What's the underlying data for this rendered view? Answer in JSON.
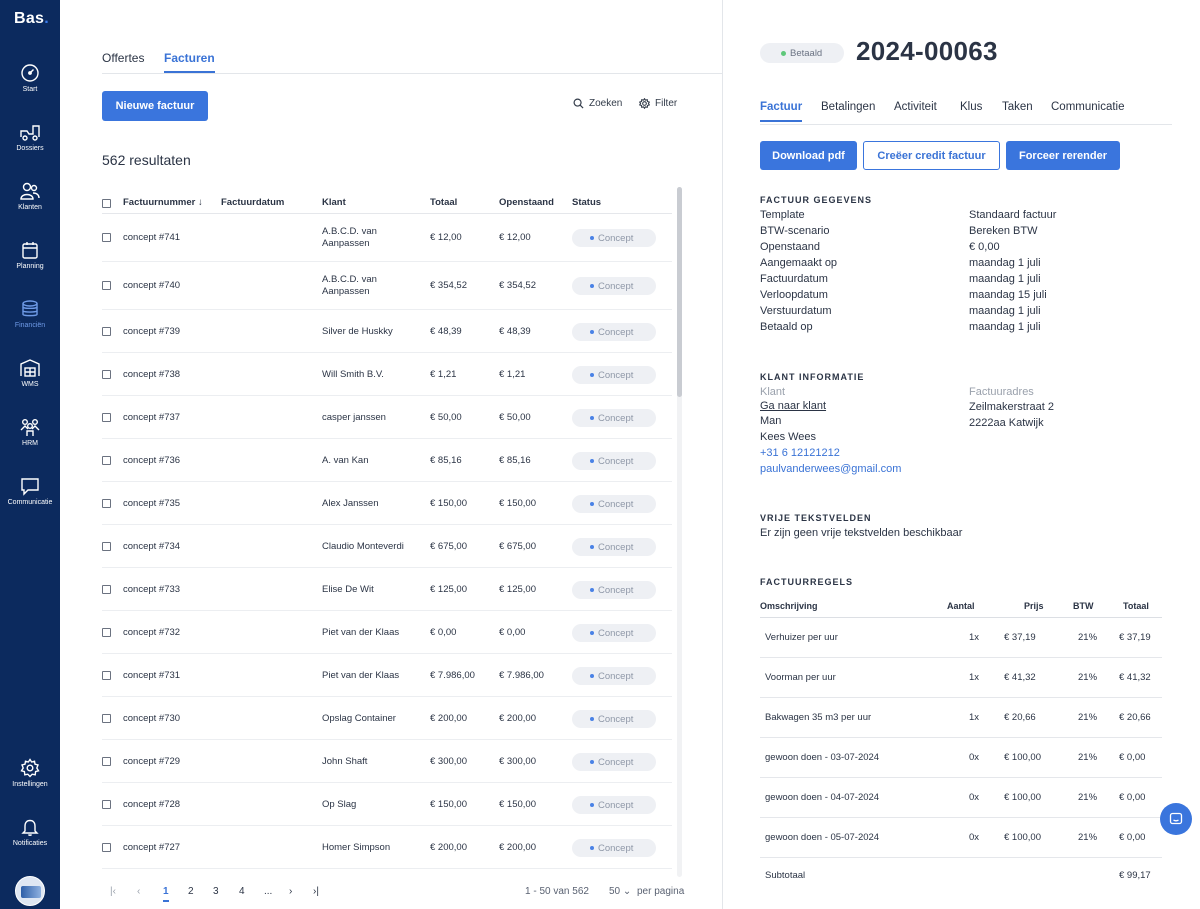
{
  "brand": {
    "logo": "Bas",
    "dot": "."
  },
  "sidebar": {
    "items": [
      {
        "label": "Start",
        "icon": "dashboard-icon"
      },
      {
        "label": "Dossiers",
        "icon": "moving-truck-icon"
      },
      {
        "label": "Klanten",
        "icon": "customers-icon"
      },
      {
        "label": "Planning",
        "icon": "calendar-icon"
      },
      {
        "label": "Financiën",
        "icon": "coins-icon",
        "active": true
      },
      {
        "label": "WMS",
        "icon": "warehouse-icon"
      },
      {
        "label": "HRM",
        "icon": "team-icon"
      },
      {
        "label": "Communicatie",
        "icon": "chat-icon"
      }
    ],
    "bottom": [
      {
        "label": "Instellingen",
        "icon": "gear-icon"
      },
      {
        "label": "Notificaties",
        "icon": "bell-icon"
      }
    ]
  },
  "left": {
    "tabs": [
      "Offertes",
      "Facturen"
    ],
    "active_tab": "Facturen",
    "new_button": "Nieuwe factuur",
    "search_label": "Zoeken",
    "filter_label": "Filter",
    "results": "562 resultaten",
    "columns": [
      "Factuurnummer",
      "Factuurdatum",
      "Klant",
      "Totaal",
      "Openstaand",
      "Status"
    ],
    "rows": [
      {
        "nr": "concept #741",
        "date": "",
        "client": [
          "A.B.C.D. van",
          "Aanpassen"
        ],
        "total": "€ 12,00",
        "open": "€ 12,00",
        "status": "Concept"
      },
      {
        "nr": "concept #740",
        "date": "",
        "client": [
          "A.B.C.D. van",
          "Aanpassen"
        ],
        "total": "€ 354,52",
        "open": "€ 354,52",
        "status": "Concept"
      },
      {
        "nr": "concept #739",
        "date": "",
        "client": [
          "Silver de Huskky"
        ],
        "total": "€ 48,39",
        "open": "€ 48,39",
        "status": "Concept"
      },
      {
        "nr": "concept #738",
        "date": "",
        "client": [
          "Will Smith B.V."
        ],
        "total": "€ 1,21",
        "open": "€ 1,21",
        "status": "Concept"
      },
      {
        "nr": "concept #737",
        "date": "",
        "client": [
          "casper janssen"
        ],
        "total": "€ 50,00",
        "open": "€ 50,00",
        "status": "Concept"
      },
      {
        "nr": "concept #736",
        "date": "",
        "client": [
          "A. van Kan"
        ],
        "total": "€ 85,16",
        "open": "€ 85,16",
        "status": "Concept"
      },
      {
        "nr": "concept #735",
        "date": "",
        "client": [
          "Alex Janssen"
        ],
        "total": "€ 150,00",
        "open": "€ 150,00",
        "status": "Concept"
      },
      {
        "nr": "concept #734",
        "date": "",
        "client": [
          "Claudio Monteverdi"
        ],
        "total": "€ 675,00",
        "open": "€ 675,00",
        "status": "Concept"
      },
      {
        "nr": "concept #733",
        "date": "",
        "client": [
          "Elise De Wit"
        ],
        "total": "€ 125,00",
        "open": "€ 125,00",
        "status": "Concept"
      },
      {
        "nr": "concept #732",
        "date": "",
        "client": [
          "Piet van der Klaas"
        ],
        "total": "€ 0,00",
        "open": "€ 0,00",
        "status": "Concept"
      },
      {
        "nr": "concept #731",
        "date": "",
        "client": [
          "Piet van der Klaas"
        ],
        "total": "€ 7.986,00",
        "open": "€ 7.986,00",
        "status": "Concept"
      },
      {
        "nr": "concept #730",
        "date": "",
        "client": [
          "Opslag Container"
        ],
        "total": "€ 200,00",
        "open": "€ 200,00",
        "status": "Concept"
      },
      {
        "nr": "concept #729",
        "date": "",
        "client": [
          "John Shaft"
        ],
        "total": "€ 300,00",
        "open": "€ 300,00",
        "status": "Concept"
      },
      {
        "nr": "concept #728",
        "date": "",
        "client": [
          "Op Slag"
        ],
        "total": "€ 150,00",
        "open": "€ 150,00",
        "status": "Concept"
      },
      {
        "nr": "concept #727",
        "date": "",
        "client": [
          "Homer Simpson"
        ],
        "total": "€ 200,00",
        "open": "€ 200,00",
        "status": "Concept"
      }
    ],
    "pagination": {
      "pages": [
        "1",
        "2",
        "3",
        "4",
        "..."
      ],
      "current": "1",
      "range": "1 - 50 van 562",
      "per_page_value": "50",
      "per_page_label": "per pagina"
    }
  },
  "right": {
    "status": "Betaald",
    "status_color": "#5fc87a",
    "number": "2024-00063",
    "tabs": [
      "Factuur",
      "Betalingen",
      "Activiteit",
      "Klus",
      "Taken",
      "Communicatie"
    ],
    "active_tab": "Factuur",
    "buttons": {
      "download": "Download pdf",
      "credit": "Creëer credit factuur",
      "rerender": "Forceer rerender"
    },
    "details": {
      "title": "FACTUUR GEGEVENS",
      "rows": [
        {
          "k": "Template",
          "v": "Standaard factuur"
        },
        {
          "k": "BTW-scenario",
          "v": "Bereken BTW"
        },
        {
          "k": "Openstaand",
          "v": "€ 0,00"
        },
        {
          "k": "Aangemaakt op",
          "v": "maandag 1 juli"
        },
        {
          "k": "Factuurdatum",
          "v": "maandag 1 juli"
        },
        {
          "k": "Verloopdatum",
          "v": "maandag 15 juli"
        },
        {
          "k": "Verstuurdatum",
          "v": "maandag 1 juli"
        },
        {
          "k": "Betaald op",
          "v": "maandag 1 juli"
        }
      ]
    },
    "client": {
      "title": "KLANT INFORMATIE",
      "label": "Klant",
      "link": "Ga naar klant",
      "gender": "Man",
      "name": "Kees Wees",
      "phone": "+31 6 12121212",
      "email": "paulvanderwees@gmail.com",
      "address_label": "Factuuradres",
      "street": "Zeilmakerstraat 2",
      "city": "2222aa Katwijk"
    },
    "free_fields": {
      "title": "VRIJE TEKSTVELDEN",
      "text": "Er zijn geen vrije tekstvelden beschikbaar"
    },
    "lines": {
      "title": "FACTUURREGELS",
      "headers": [
        "Omschrijving",
        "Aantal",
        "Prijs",
        "BTW",
        "Totaal"
      ],
      "rows": [
        {
          "desc": "Verhuizer per uur",
          "qty": "1x",
          "price": "€ 37,19",
          "vat": "21%",
          "total": "€ 37,19"
        },
        {
          "desc": "Voorman per uur",
          "qty": "1x",
          "price": "€ 41,32",
          "vat": "21%",
          "total": "€ 41,32"
        },
        {
          "desc": "Bakwagen 35 m3 per uur",
          "qty": "1x",
          "price": "€ 20,66",
          "vat": "21%",
          "total": "€ 20,66"
        },
        {
          "desc": "gewoon doen - 03-07-2024",
          "qty": "0x",
          "price": "€ 100,00",
          "vat": "21%",
          "total": "€ 0,00"
        },
        {
          "desc": "gewoon doen - 04-07-2024",
          "qty": "0x",
          "price": "€ 100,00",
          "vat": "21%",
          "total": "€ 0,00"
        },
        {
          "desc": "gewoon doen - 05-07-2024",
          "qty": "0x",
          "price": "€ 100,00",
          "vat": "21%",
          "total": "€ 0,00"
        }
      ],
      "subtotal_label": "Subtotaal",
      "subtotal_value": "€ 99,17"
    }
  },
  "colors": {
    "sidebar": "#0c2a5e",
    "accent": "#3a75dd",
    "badge_dot": "#4a82e6"
  }
}
